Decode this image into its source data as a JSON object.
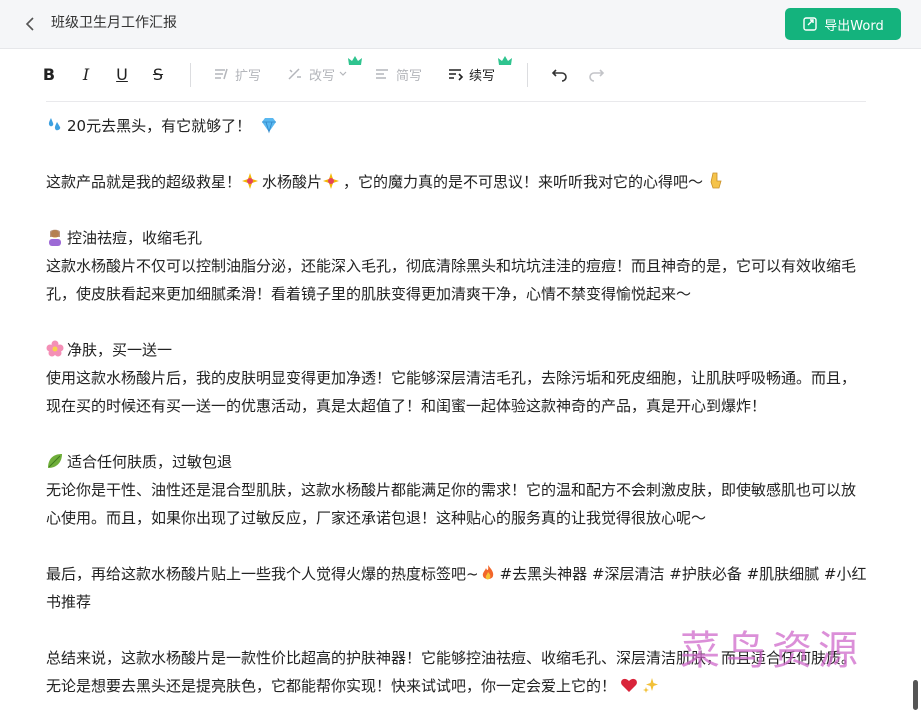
{
  "header": {
    "title": "班级卫生月工作汇报",
    "export_label": "导出Word"
  },
  "toolbar": {
    "bold": "B",
    "italic": "I",
    "underline": "U",
    "strike": "S",
    "expand_label": "扩写",
    "rewrite_label": "改写",
    "simplify_label": "简写",
    "continue_label": "续写"
  },
  "content": {
    "p1": "20元去黑头，有它就够了！",
    "p2a": "这款产品就是我的超级救星！",
    "p2b": "水杨酸片",
    "p2c": "，它的魔力真的是不可思议！来听听我对它的心得吧～",
    "h1": "控油祛痘，收缩毛孔",
    "b1": "这款水杨酸片不仅可以控制油脂分泌，还能深入毛孔，彻底清除黑头和坑坑洼洼的痘痘！而且神奇的是，它可以有效收缩毛孔，使皮肤看起来更加细腻柔滑！看着镜子里的肌肤变得更加清爽干净，心情不禁变得愉悦起来～",
    "h2": "净肤，买一送一",
    "b2": "使用这款水杨酸片后，我的皮肤明显变得更加净透！它能够深层清洁毛孔，去除污垢和死皮细胞，让肌肤呼吸畅通。而且，现在买的时候还有买一送一的优惠活动，真是太超值了！和闺蜜一起体验这款神奇的产品，真是开心到爆炸！",
    "h3": "适合任何肤质，过敏包退",
    "b3": "无论你是干性、油性还是混合型肌肤，这款水杨酸片都能满足你的需求！它的温和配方不会刺激皮肤，即使敏感肌也可以放心使用。而且，如果你出现了过敏反应，厂家还承诺包退！这种贴心的服务真的让我觉得很放心呢～",
    "tags_a": "最后，再给这款水杨酸片贴上一些我个人觉得火爆的热度标签吧~",
    "tags_b": "#去黑头神器 #深层清洁 #护肤必备 #肌肤细腻 #小红书推荐",
    "summary": "总结来说，这款水杨酸片是一款性价比超高的护肤神器！它能够控油祛痘、收缩毛孔、深层清洁肌肤，而且适合任何肤质。无论是想要去黑头还是提亮肤色，它都能帮你实现！快来试试吧，你一定会爱上它的！"
  },
  "watermark": "菜鸟资源",
  "colors": {
    "accent": "#14b37d",
    "watermark": "#d06acb"
  },
  "icons": [
    "back-icon",
    "export-icon",
    "expand-icon",
    "rewrite-icon",
    "simplify-icon",
    "continue-icon",
    "crown-icon",
    "undo-icon",
    "redo-icon"
  ]
}
